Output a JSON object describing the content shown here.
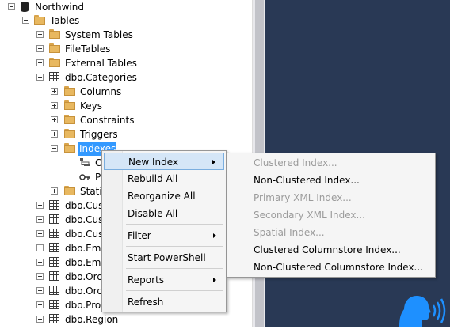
{
  "tree": {
    "database": "Northwind",
    "tables_label": "Tables",
    "system_tables": "System Tables",
    "file_tables": "FileTables",
    "external_tables": "External Tables",
    "categories": "dbo.Categories",
    "columns": "Columns",
    "keys": "Keys",
    "constraints": "Constraints",
    "triggers": "Triggers",
    "indexes": "Indexes",
    "index_child_1": "C",
    "index_child_2": "P",
    "statistics_partial": "Stati",
    "tables": [
      "dbo.Cus",
      "dbo.Cus",
      "dbo.Cus",
      "dbo.Emp",
      "dbo.Emp",
      "dbo.Ord",
      "dbo.Ord",
      "dbo.Pro",
      "dbo.Region"
    ]
  },
  "context_menu": {
    "new_index": "New Index",
    "rebuild_all": "Rebuild All",
    "reorganize_all": "Reorganize All",
    "disable_all": "Disable All",
    "filter": "Filter",
    "start_powershell": "Start PowerShell",
    "reports": "Reports",
    "refresh": "Refresh"
  },
  "submenu": {
    "clustered": "Clustered Index...",
    "non_clustered": "Non-Clustered Index...",
    "primary_xml": "Primary XML Index...",
    "secondary_xml": "Secondary XML Index...",
    "spatial": "Spatial Index...",
    "clustered_columnstore": "Clustered Columnstore Index...",
    "non_clustered_columnstore": "Non-Clustered Columnstore Index..."
  },
  "colors": {
    "selection": "#3399ff",
    "menu_highlight": "#d5e6f7",
    "right_pane": "#293955",
    "logo": "#1e90ff",
    "disabled_text": "#9b9b9b"
  },
  "icons": {
    "expand": "expand-icon",
    "collapse": "collapse-icon",
    "folder": "folder-icon",
    "table": "table-icon",
    "database": "database-icon",
    "submenu_arrow": "submenu-arrow-icon",
    "logo": "speaking-head-icon"
  }
}
